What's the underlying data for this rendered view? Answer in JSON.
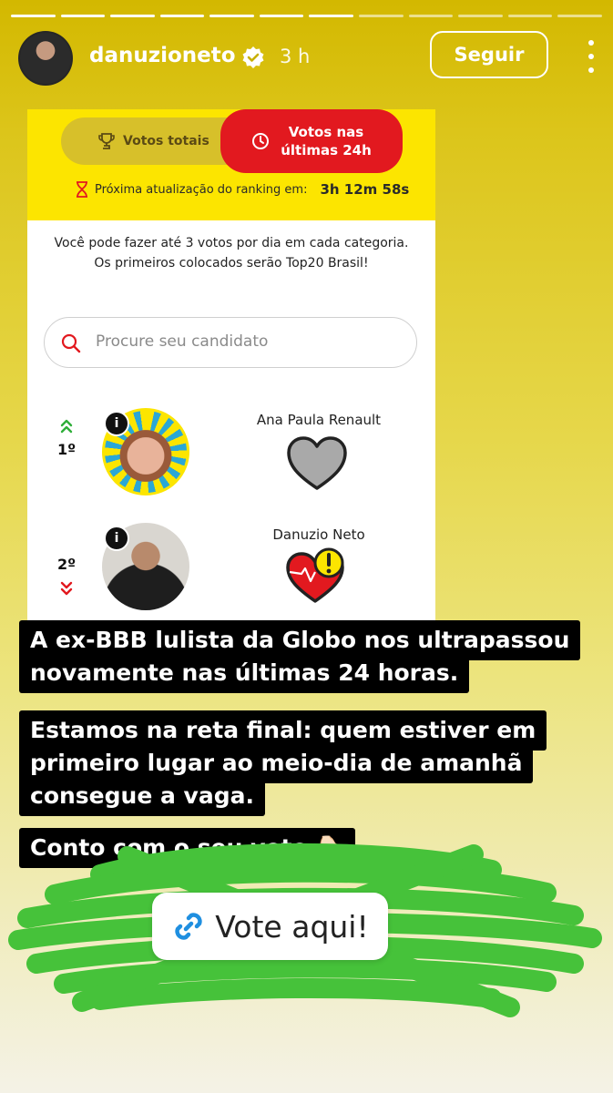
{
  "story": {
    "segments_total": 12,
    "segments_done": 7
  },
  "header": {
    "username": "danuzioneto",
    "time": "3 h",
    "follow_label": "Seguir",
    "icons": [
      "avatar",
      "verified-badge-icon",
      "more-options-icon"
    ]
  },
  "ranking": {
    "tab_total_label": "Votos totais",
    "tab_24h_label_line1": "Votos nas",
    "tab_24h_label_line2": "últimas 24h",
    "update_label": "Próxima atualização do ranking em:",
    "update_countdown": "3h 12m 58s",
    "info_text": "Você pode fazer até 3 votos por dia em cada categoria. Os primeiros colocados serão Top20 Brasil!",
    "search_placeholder": "Procure seu candidato",
    "candidates": [
      {
        "rank": "1º",
        "name": "Ana Paula Renault",
        "trend": "up"
      },
      {
        "rank": "2º",
        "name": "Danuzio Neto",
        "trend": "down"
      }
    ],
    "colors": {
      "yellow": "#fce500",
      "red": "#e2191f"
    }
  },
  "captions": {
    "line1a": "A ex-BBB lulista da Globo nos ultrapassou",
    "line1b": "novamente nas últimas 24 horas.",
    "line2a": "Estamos na reta final: quem estiver em",
    "line2b": "primeiro lugar ao meio-dia de amanhã",
    "line2c": "consegue a vaga.",
    "line3": "Conto com o seu voto 👇🏻"
  },
  "link_sticker": {
    "label": "Vote aqui!",
    "icon": "link-icon"
  }
}
